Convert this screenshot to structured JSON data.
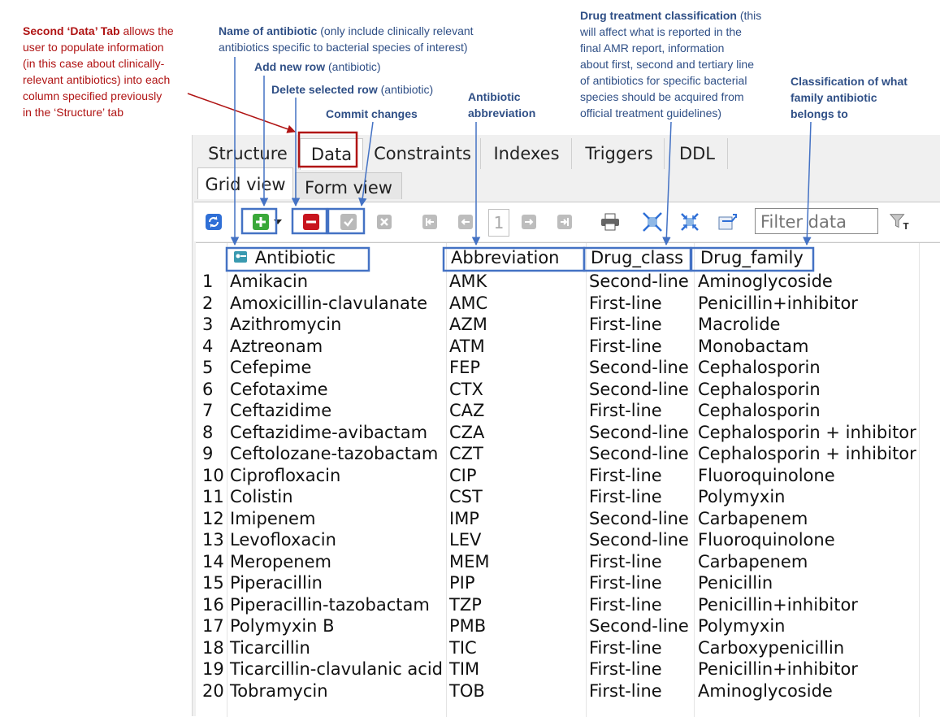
{
  "annotations": {
    "data_tab": {
      "bold": "Second ‘Data’ Tab",
      "lines": [
        "allows the",
        "user to populate information",
        "(in this case about clinically-",
        "relevant antibiotics) into each",
        "column specified previously",
        "in the ‘Structure’ tab"
      ]
    },
    "name_of_antibiotic": {
      "bold": "Name of antibiotic",
      "rest": "(only include clinically relevant",
      "line2": "antibiotics specific to bacterial species of interest)"
    },
    "add_new_row": {
      "bold": "Add new row",
      "rest": "(antibiotic)"
    },
    "delete_row": {
      "bold": "Delete selected row",
      "rest": "(antibiotic)"
    },
    "commit": {
      "bold": "Commit changes"
    },
    "abbreviation": {
      "line1": "Antibiotic",
      "line2": "abbreviation"
    },
    "drug_class": {
      "bold": "Drug treatment classification",
      "rest": "(this",
      "lines": [
        "will affect what is reported in the",
        "final AMR report, information",
        "about first, second and tertiary line",
        "of antibiotics for specific bacterial",
        "species should be acquired from",
        "official treatment guidelines)"
      ]
    },
    "family": {
      "lines": [
        "Classification of what",
        "family antibiotic",
        "belongs to"
      ]
    }
  },
  "colors": {
    "annotation_red": "#b01414",
    "annotation_blue": "#2f4f86",
    "box_blue": "#4472c4",
    "box_red": "#b01414"
  },
  "tabs": [
    "Structure",
    "Data",
    "Constraints",
    "Indexes",
    "Triggers",
    "DDL"
  ],
  "active_tab": "Data",
  "subtabs": [
    "Grid view",
    "Form view"
  ],
  "toolbar": {
    "icons": [
      "refresh-icon",
      "add-row-icon",
      "dropdown-arrow-icon",
      "delete-row-icon",
      "commit-icon",
      "rollback-icon",
      "first-page-icon",
      "prev-page-icon",
      "next-page-icon",
      "last-page-icon",
      "print-icon",
      "expand-icon",
      "collapse-icon",
      "export-icon",
      "filter-icon"
    ],
    "page": "1",
    "filter_placeholder": "Filter data"
  },
  "grid": {
    "columns": [
      "Antibiotic",
      "Abbreviation",
      "Drug_class",
      "Drug_family"
    ],
    "rows": [
      {
        "n": "1",
        "antibiotic": "Amikacin",
        "abbr": "AMK",
        "cls": "Second-line",
        "family": "Aminoglycoside"
      },
      {
        "n": "2",
        "antibiotic": "Amoxicillin-clavulanate",
        "abbr": "AMC",
        "cls": "First-line",
        "family": "Penicillin+inhibitor"
      },
      {
        "n": "3",
        "antibiotic": "Azithromycin",
        "abbr": "AZM",
        "cls": "First-line",
        "family": "Macrolide"
      },
      {
        "n": "4",
        "antibiotic": "Aztreonam",
        "abbr": "ATM",
        "cls": "First-line",
        "family": "Monobactam"
      },
      {
        "n": "5",
        "antibiotic": "Cefepime",
        "abbr": "FEP",
        "cls": "Second-line",
        "family": "Cephalosporin"
      },
      {
        "n": "6",
        "antibiotic": "Cefotaxime",
        "abbr": "CTX",
        "cls": "Second-line",
        "family": "Cephalosporin"
      },
      {
        "n": "7",
        "antibiotic": "Ceftazidime",
        "abbr": "CAZ",
        "cls": "First-line",
        "family": "Cephalosporin"
      },
      {
        "n": "8",
        "antibiotic": "Ceftazidime-avibactam",
        "abbr": "CZA",
        "cls": "Second-line",
        "family": "Cephalosporin + inhibitor"
      },
      {
        "n": "9",
        "antibiotic": "Ceftolozane-tazobactam",
        "abbr": "CZT",
        "cls": "Second-line",
        "family": "Cephalosporin + inhibitor"
      },
      {
        "n": "10",
        "antibiotic": "Ciprofloxacin",
        "abbr": "CIP",
        "cls": "First-line",
        "family": "Fluoroquinolone"
      },
      {
        "n": "11",
        "antibiotic": "Colistin",
        "abbr": "CST",
        "cls": "First-line",
        "family": "Polymyxin"
      },
      {
        "n": "12",
        "antibiotic": "Imipenem",
        "abbr": "IMP",
        "cls": "Second-line",
        "family": "Carbapenem"
      },
      {
        "n": "13",
        "antibiotic": "Levofloxacin",
        "abbr": "LEV",
        "cls": "Second-line",
        "family": "Fluoroquinolone"
      },
      {
        "n": "14",
        "antibiotic": "Meropenem",
        "abbr": "MEM",
        "cls": "First-line",
        "family": "Carbapenem"
      },
      {
        "n": "15",
        "antibiotic": "Piperacillin",
        "abbr": "PIP",
        "cls": "First-line",
        "family": "Penicillin"
      },
      {
        "n": "16",
        "antibiotic": "Piperacillin-tazobactam",
        "abbr": "TZP",
        "cls": "First-line",
        "family": "Penicillin+inhibitor"
      },
      {
        "n": "17",
        "antibiotic": "Polymyxin B",
        "abbr": "PMB",
        "cls": "Second-line",
        "family": "Polymyxin"
      },
      {
        "n": "18",
        "antibiotic": "Ticarcillin",
        "abbr": "TIC",
        "cls": "First-line",
        "family": "Carboxypenicillin"
      },
      {
        "n": "19",
        "antibiotic": "Ticarcillin-clavulanic acid",
        "abbr": "TIM",
        "cls": "First-line",
        "family": "Penicillin+inhibitor"
      },
      {
        "n": "20",
        "antibiotic": "Tobramycin",
        "abbr": "TOB",
        "cls": "First-line",
        "family": "Aminoglycoside"
      }
    ]
  }
}
